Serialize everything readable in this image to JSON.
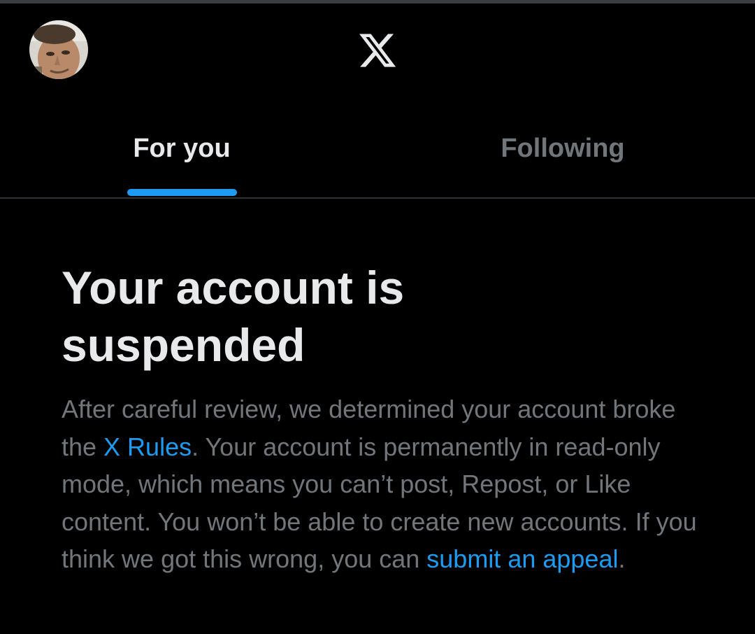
{
  "colors": {
    "background": "#000000",
    "accent": "#1d9bf0",
    "primary_text": "#e7e9ea",
    "secondary_text": "#71767b",
    "divider": "#2f3336"
  },
  "header": {
    "avatar_icon": "profile-avatar",
    "logo_icon": "x-logo",
    "tabs": [
      {
        "label": "For you",
        "active": true
      },
      {
        "label": "Following",
        "active": false
      }
    ]
  },
  "notice": {
    "title": "Your account is suspended",
    "paragraph": {
      "part1": "After careful review, we determined your account broke the ",
      "rules_link": "X Rules",
      "part2": ". Your account is permanently in read-only mode, which means you can’t post, Repost, or Like content. You won’t be able to create new accounts. If you think we got this wrong, you can ",
      "appeal_link": "submit an appeal",
      "part3": "."
    }
  }
}
